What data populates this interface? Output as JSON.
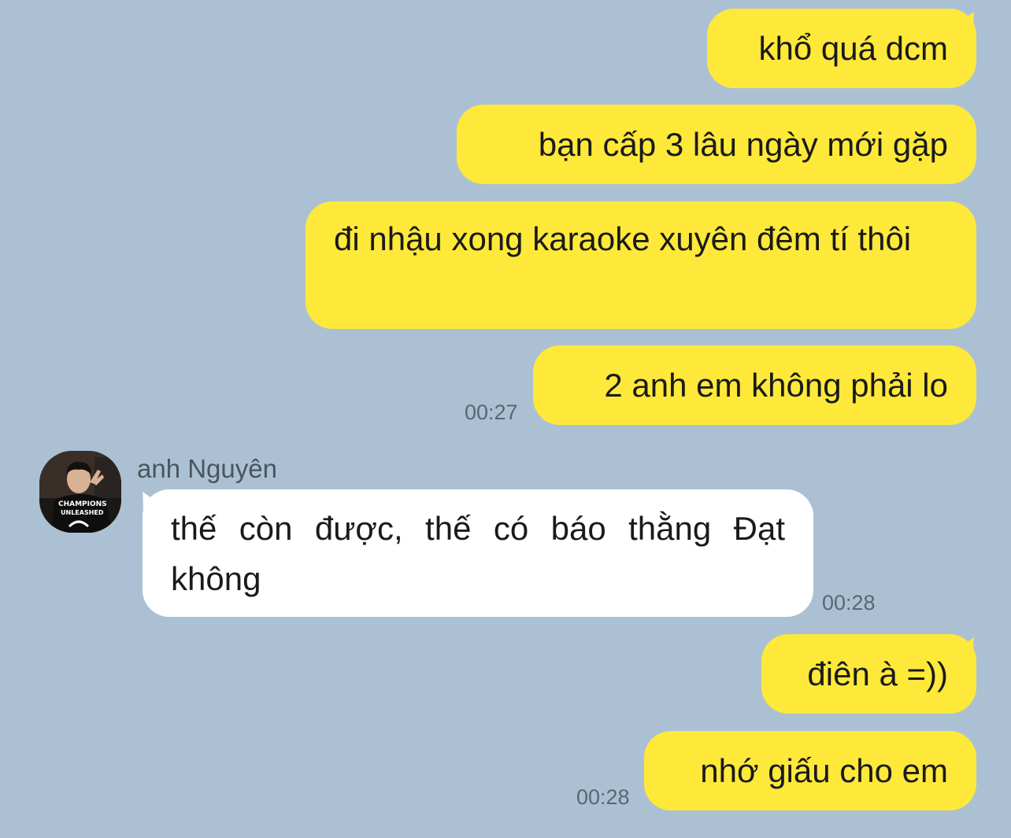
{
  "colors": {
    "background": "#abc1d3",
    "outgoing_bubble": "#fee93a",
    "incoming_bubble": "#ffffff",
    "timestamp_text": "#5a6672"
  },
  "messages": [
    {
      "direction": "out",
      "text": "khổ quá dcm"
    },
    {
      "direction": "out",
      "text": "bạn cấp 3 lâu ngày mới gặp"
    },
    {
      "direction": "out",
      "text": "đi nhậu xong karaoke xuyên đêm tí thôi"
    },
    {
      "direction": "out",
      "text": "2 anh em không phải lo",
      "time": "00:27"
    },
    {
      "direction": "in",
      "sender": "anh Nguyên",
      "text": "thế còn được, thế có báo thằng Đạt không",
      "time": "00:28"
    },
    {
      "direction": "out",
      "text": "điên à =))"
    },
    {
      "direction": "out",
      "text": "nhớ giấu cho em",
      "time": "00:28"
    }
  ],
  "contact": {
    "name": "anh Nguyên",
    "avatar_icon": "profile-photo-icon",
    "shirt_text": [
      "CHAMPIONS",
      "UNLEASHED"
    ]
  }
}
